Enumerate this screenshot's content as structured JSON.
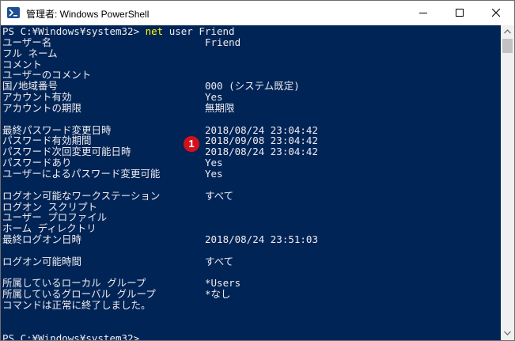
{
  "window": {
    "title": "管理者: Windows PowerShell"
  },
  "console": {
    "prompt_top": "PS C:¥Windows¥system32>",
    "command": "net",
    "command_args": "user Friend",
    "rows": [
      {
        "label": "ユーザー名",
        "value": "Friend"
      },
      {
        "label": "フル ネーム",
        "value": ""
      },
      {
        "label": "コメント",
        "value": ""
      },
      {
        "label": "ユーザーのコメント",
        "value": ""
      },
      {
        "label": "国/地域番号",
        "value": "000 (システム既定)"
      },
      {
        "label": "アカウント有効",
        "value": "Yes"
      },
      {
        "label": "アカウントの期限",
        "value": "無期限"
      },
      {
        "label": "",
        "value": ""
      },
      {
        "label": "最終パスワード変更日時",
        "value": "2018/08/24 23:04:42"
      },
      {
        "label": "パスワード有効期間",
        "value": "2018/09/08 23:04:42"
      },
      {
        "label": "パスワード次回変更可能日時",
        "value": "2018/08/24 23:04:42"
      },
      {
        "label": "パスワードあり",
        "value": "Yes"
      },
      {
        "label": "ユーザーによるパスワード変更可能",
        "value": "Yes"
      },
      {
        "label": "",
        "value": ""
      },
      {
        "label": "ログオン可能なワークステーション",
        "value": "すべて"
      },
      {
        "label": "ログオン スクリプト",
        "value": ""
      },
      {
        "label": "ユーザー プロファイル",
        "value": ""
      },
      {
        "label": "ホーム ディレクトリ",
        "value": ""
      },
      {
        "label": "最終ログオン日時",
        "value": "2018/08/24 23:51:03"
      },
      {
        "label": "",
        "value": ""
      },
      {
        "label": "ログオン可能時間",
        "value": "すべて"
      },
      {
        "label": "",
        "value": ""
      },
      {
        "label": "所属しているローカル グループ",
        "value": "*Users"
      },
      {
        "label": "所属しているグローバル グループ",
        "value": "*なし"
      },
      {
        "label": "コマンドは正常に終了しました。",
        "value": ""
      },
      {
        "label": "",
        "value": ""
      },
      {
        "label": "",
        "value": ""
      }
    ],
    "prompt_bottom": "PS C:¥Windows¥system32>"
  },
  "annotation": {
    "badge_number": "1"
  },
  "colors": {
    "console_background": "#012456",
    "console_text": "#eeedf0",
    "command_highlight": "#ffff00",
    "badge": "#d3111c"
  },
  "icons": {
    "app": "powershell-icon",
    "minimize": "minimize-icon",
    "maximize": "maximize-icon",
    "close": "close-icon"
  }
}
